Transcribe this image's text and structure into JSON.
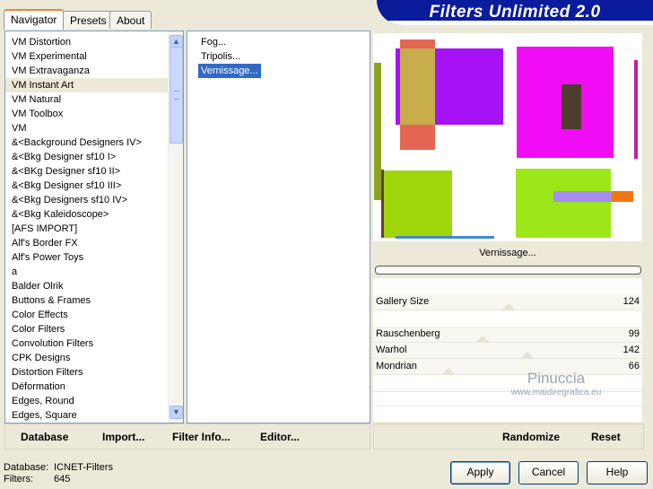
{
  "tabs": [
    {
      "label": "Navigator"
    },
    {
      "label": "Presets"
    },
    {
      "label": "About"
    }
  ],
  "app_title": "Filters Unlimited 2.0",
  "categories": [
    "VM Distortion",
    "VM Experimental",
    "VM Extravaganza",
    "VM Instant Art",
    "VM Natural",
    "VM Toolbox",
    "VM",
    "&<Background Designers IV>",
    "&<Bkg Designer sf10 I>",
    "&<BKg Designer sf10 II>",
    "&<Bkg Designer sf10 III>",
    "&<Bkg Designers sf10 IV>",
    "&<Bkg Kaleidoscope>",
    "[AFS IMPORT]",
    "Alf's Border FX",
    "Alf's Power Toys",
    "a",
    "Balder Olrik",
    "Buttons & Frames",
    "Color Effects",
    "Color Filters",
    "Convolution Filters",
    "CPK Designs",
    "Distortion Filters",
    "Déformation",
    "Edges, Round",
    "Edges, Square"
  ],
  "selected_category": "VM Instant Art",
  "filters": [
    "Fog...",
    "Tripolis...",
    "Vernissage..."
  ],
  "selected_filter": "Vernissage...",
  "left_toolbar": {
    "database": "Database",
    "import": "Import...",
    "filter_info": "Filter Info...",
    "editor": "Editor..."
  },
  "right_toolbar": {
    "randomize": "Randomize",
    "reset": "Reset"
  },
  "preview_name": "Vernissage...",
  "controls": [
    {
      "label": "Gallery Size",
      "value": "124",
      "fraction": 0.49
    },
    {
      "label": "Rauschenberg",
      "value": "99",
      "fraction": 0.39
    },
    {
      "label": "Warhol",
      "value": "142",
      "fraction": 0.56
    },
    {
      "label": "Mondrian",
      "value": "66",
      "fraction": 0.26
    }
  ],
  "status": {
    "database_label": "Database:",
    "database_value": "ICNET-Filters",
    "filters_label": "Filters:",
    "filters_value": "645"
  },
  "buttons": {
    "apply": "Apply",
    "cancel": "Cancel",
    "help": "Help"
  },
  "watermark": {
    "name": "Pinuccia",
    "url": "www.maidiregrafica.eu"
  },
  "scroll_up_icon": "chevron-up-icon",
  "scroll_down_icon": "chevron-down-icon",
  "colors": {
    "title_bar": "#0a1b9b",
    "selection": "#316ac5",
    "active_tab_accent": "#e68b2c"
  }
}
